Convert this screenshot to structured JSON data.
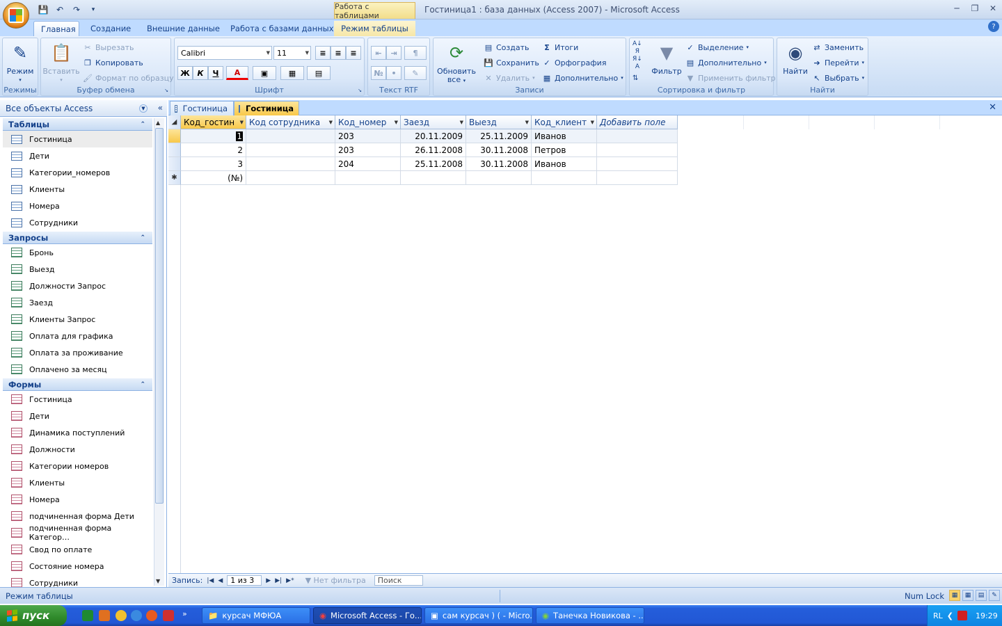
{
  "titlebar": {
    "context_tab": "Работа с таблицами",
    "title": "Гостиница1 : база данных (Access 2007)  -  Microsoft Access"
  },
  "tabs": {
    "home": "Главная",
    "create": "Создание",
    "external": "Внешние данные",
    "dbtools": "Работа с базами данных",
    "datasheet": "Режим таблицы"
  },
  "ribbon": {
    "views": {
      "mode": "Режим",
      "label": "Режимы"
    },
    "clipboard": {
      "paste": "Вставить",
      "cut": "Вырезать",
      "copy": "Копировать",
      "format_painter": "Формат по образцу",
      "label": "Буфер обмена"
    },
    "font": {
      "font_name": "Calibri",
      "font_size": "11",
      "bold": "Ж",
      "italic": "К",
      "underline": "Ч",
      "font_color": "A",
      "label": "Шрифт"
    },
    "rtf": {
      "label": "Текст RTF"
    },
    "records": {
      "refresh": "Обновить",
      "refresh_all": "все",
      "new": "Создать",
      "save": "Сохранить",
      "delete": "Удалить",
      "totals": "Итоги",
      "spelling": "Орфография",
      "more": "Дополнительно",
      "label": "Записи"
    },
    "sort": {
      "filter": "Фильтр",
      "selection": "Выделение",
      "advanced": "Дополнительно",
      "toggle": "Применить фильтр",
      "label": "Сортировка и фильтр"
    },
    "find": {
      "find": "Найти",
      "replace": "Заменить",
      "goto": "Перейти",
      "select": "Выбрать",
      "label": "Найти"
    }
  },
  "nav": {
    "header": "Все объекты Access",
    "sections": [
      {
        "title": "Таблицы",
        "items": [
          "Гостиница",
          "Дети",
          "Категории_номеров",
          "Клиенты",
          "Номера",
          "Сотрудники"
        ]
      },
      {
        "title": "Запросы",
        "items": [
          "Бронь",
          "Выезд",
          "Должности Запрос",
          "Заезд",
          "Клиенты Запрос",
          "Оплата для графика",
          "Оплата за проживание",
          "Оплачено за месяц"
        ]
      },
      {
        "title": "Формы",
        "items": [
          "Гостиница",
          "Дети",
          "Динамика поступлений",
          "Должности",
          "Категории номеров",
          "Клиенты",
          "Номера",
          "подчиненная форма Дети",
          "подчиненная форма Категор…",
          "Свод по оплате",
          "Состояние номера",
          "Сотрудники"
        ]
      }
    ]
  },
  "doc": {
    "tabs": [
      "Гостиница",
      "Гостиница"
    ],
    "columns": [
      "Код_гостин",
      "Код сотрудника",
      "Код_номер",
      "Заезд",
      "Выезд",
      "Код_клиент",
      "Добавить поле"
    ],
    "rows": [
      [
        "1",
        "",
        "203",
        "20.11.2009",
        "25.11.2009",
        "Иванов",
        ""
      ],
      [
        "2",
        "",
        "203",
        "26.11.2008",
        "30.11.2008",
        "Петров",
        ""
      ],
      [
        "3",
        "",
        "204",
        "25.11.2008",
        "30.11.2008",
        "Иванов",
        ""
      ]
    ],
    "new_row": "(№)"
  },
  "recnav": {
    "label": "Запись:",
    "position": "1 из 3",
    "filter": "Нет фильтра",
    "search": "Поиск"
  },
  "status": {
    "left": "Режим таблицы",
    "numlock": "Num Lock"
  },
  "taskbar": {
    "start": "пуск",
    "items": [
      "курсач МФЮА",
      "Microsoft Access - Го...",
      "сам курсач ) ( - Micro...",
      "Танечка Новикова - ..."
    ],
    "lang": "RL",
    "time": "19:29"
  },
  "colors": {
    "ribbon_bg": "#c7dbf4",
    "active_tab": "#f8c84a",
    "taskbar": "#245edb",
    "start": "#2f8a2b"
  }
}
